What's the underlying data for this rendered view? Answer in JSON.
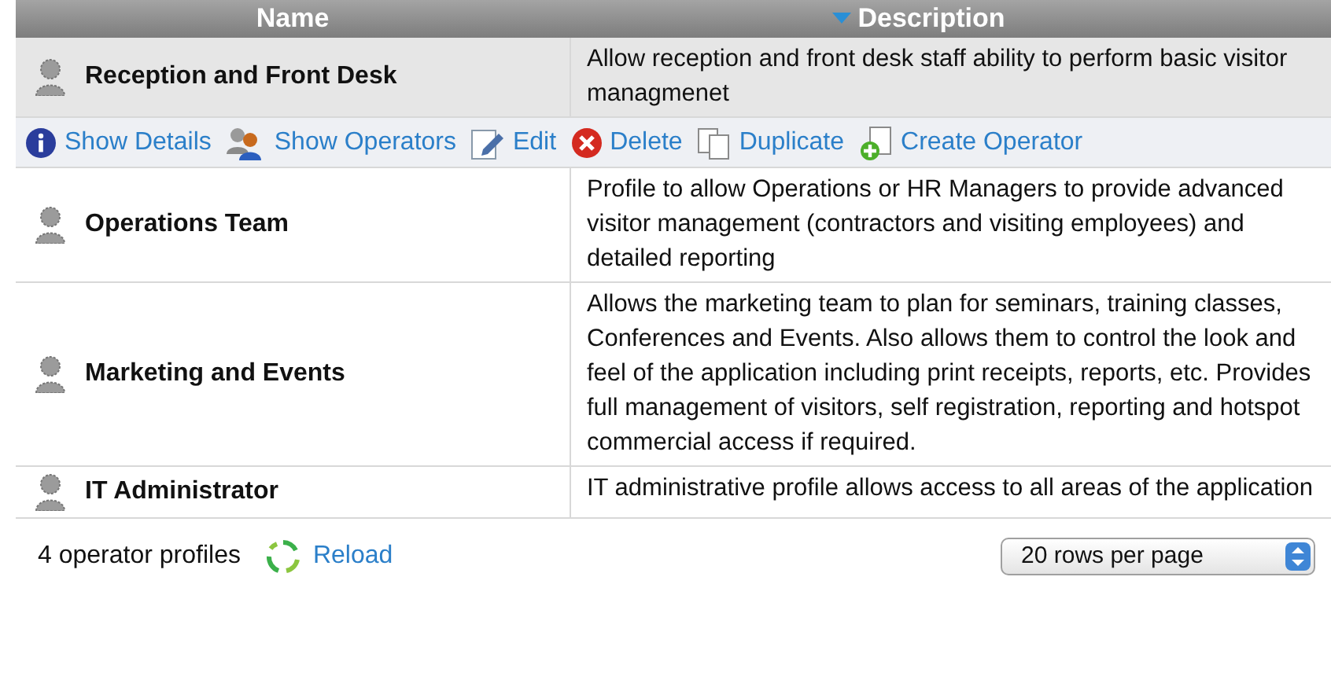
{
  "table": {
    "columns": [
      {
        "label": "Name",
        "sorted": false
      },
      {
        "label": "Description",
        "sorted": true
      }
    ],
    "rows": [
      {
        "name": "Reception and Front Desk",
        "description": "Allow reception and front desk staff ability to perform basic visitor managmenet",
        "selected": true
      },
      {
        "name": "Operations Team",
        "description": "Profile to allow Operations or HR Managers to provide advanced visitor management (contractors and visiting employees) and detailed reporting",
        "selected": false
      },
      {
        "name": "Marketing and Events",
        "description": "Allows the marketing team to plan for seminars, training classes, Conferences and Events. Also allows them to control the look and feel of the application including print receipts, reports, etc. Provides full management of visitors, self registration, reporting and hotspot commercial access if required.",
        "selected": false
      },
      {
        "name": "IT Administrator",
        "description": "IT administrative profile allows access to all areas of the application",
        "selected": false
      }
    ],
    "actions": [
      {
        "kind": "info",
        "label": "Show Details"
      },
      {
        "kind": "operators",
        "label": "Show Operators"
      },
      {
        "kind": "edit",
        "label": "Edit"
      },
      {
        "kind": "delete",
        "label": "Delete"
      },
      {
        "kind": "duplicate",
        "label": "Duplicate"
      },
      {
        "kind": "create",
        "label": "Create Operator"
      }
    ]
  },
  "footer": {
    "count": "4 operator profiles",
    "reload": "Reload",
    "page_size": "20 rows per page"
  }
}
